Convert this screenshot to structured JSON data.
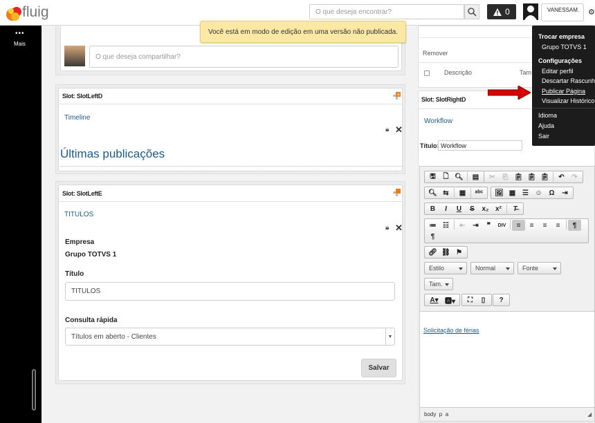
{
  "header": {
    "logo_text": "fluig",
    "search_placeholder": "O que deseja encontrar?",
    "alert_count": "0",
    "username": "VANESSAM."
  },
  "leftnav": {
    "more_label": "Mais"
  },
  "notice": "Você está em modo de edição em uma versão não publicada.",
  "share": {
    "placeholder": "O que deseja compartilhar?"
  },
  "slot_left_d": {
    "title": "Slot: SlotLeftD",
    "widget_link": "Timeline",
    "heading": "Últimas publicações"
  },
  "slot_left_e": {
    "title": "Slot: SlotLeftE",
    "widget_link": "TITULOS",
    "empresa_label": "Empresa",
    "empresa_value": "Grupo TOTVS 1",
    "titulo_label": "Título",
    "titulo_value": "TITULOS",
    "consulta_label": "Consulta rápida",
    "consulta_value": "Títulos em aberto - Clientes",
    "save_label": "Salvar"
  },
  "right_top": {
    "remove_label": "Remover",
    "col_descricao": "Descrição",
    "col_tam": "Tam"
  },
  "slot_right_d": {
    "title": "Slot: SlotRightD",
    "widget_link": "Workflow",
    "titulo_label": "Título:",
    "titulo_value": "Workflow"
  },
  "editor": {
    "estilo": "Estilo",
    "normal": "Normal",
    "fonte": "Fonte",
    "tamanho": "Tam.",
    "content_link": "Solicitação de férias",
    "status_path": "body  p  a"
  },
  "dropdown": {
    "section1": "Trocar empresa",
    "company": "Grupo TOTVS 1",
    "section2": "Configurações",
    "items": [
      "Editar perfil",
      "Descartar Rascunho",
      "Publicar Página",
      "Visualizar Histórico"
    ],
    "idioma": "Idioma",
    "ajuda": "Ajuda",
    "sair": "Sair"
  },
  "colors": {
    "accent_arrow": "#d90000",
    "link": "#1c5a8a",
    "notice_bg": "#fbe8a4"
  }
}
